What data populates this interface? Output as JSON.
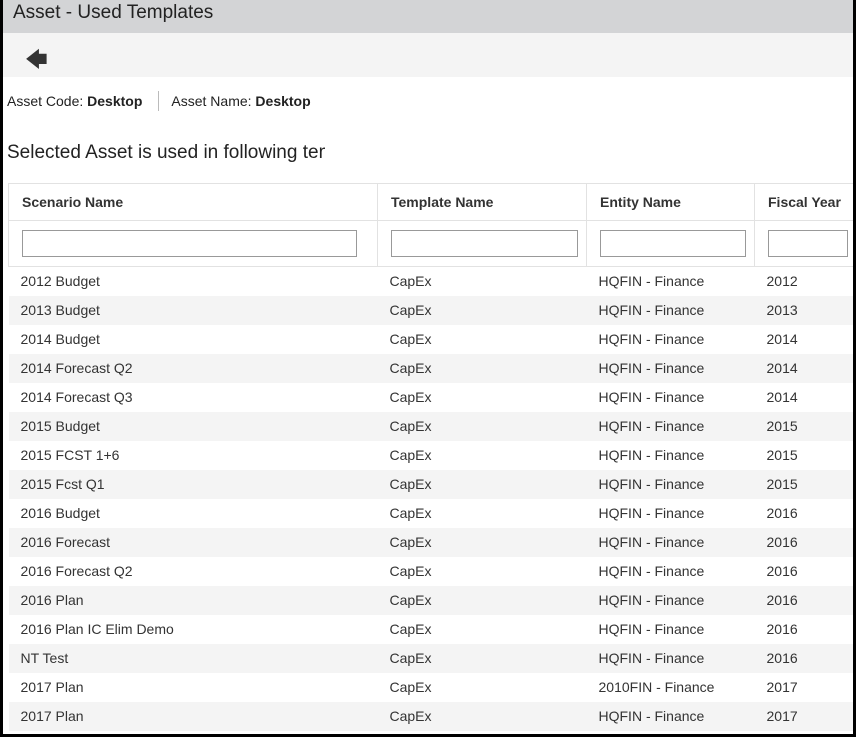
{
  "title": "Asset - Used Templates",
  "toolbar": {
    "back_icon": "arrow-left-icon"
  },
  "info": {
    "code_label": "Asset Code:",
    "code_value": "Desktop",
    "name_label": "Asset Name:",
    "name_value": "Desktop"
  },
  "heading": "Selected Asset is used in following templates",
  "columns": [
    "Scenario Name",
    "Template Name",
    "Entity Name",
    "Fiscal Year"
  ],
  "rows": [
    [
      "2012 Budget",
      "CapEx",
      "HQFIN - Finance",
      "2012"
    ],
    [
      "2013 Budget",
      "CapEx",
      "HQFIN - Finance",
      "2013"
    ],
    [
      "2014 Budget",
      "CapEx",
      "HQFIN - Finance",
      "2014"
    ],
    [
      "2014 Forecast Q2",
      "CapEx",
      "HQFIN - Finance",
      "2014"
    ],
    [
      "2014 Forecast Q3",
      "CapEx",
      "HQFIN - Finance",
      "2014"
    ],
    [
      "2015 Budget",
      "CapEx",
      "HQFIN - Finance",
      "2015"
    ],
    [
      "2015 FCST 1+6",
      "CapEx",
      "HQFIN - Finance",
      "2015"
    ],
    [
      "2015 Fcst Q1",
      "CapEx",
      "HQFIN - Finance",
      "2015"
    ],
    [
      "2016 Budget",
      "CapEx",
      "HQFIN - Finance",
      "2016"
    ],
    [
      "2016 Forecast",
      "CapEx",
      "HQFIN - Finance",
      "2016"
    ],
    [
      "2016 Forecast Q2",
      "CapEx",
      "HQFIN - Finance",
      "2016"
    ],
    [
      "2016 Plan",
      "CapEx",
      "HQFIN - Finance",
      "2016"
    ],
    [
      "2016 Plan IC Elim Demo",
      "CapEx",
      "HQFIN - Finance",
      "2016"
    ],
    [
      "NT Test",
      "CapEx",
      "HQFIN - Finance",
      "2016"
    ],
    [
      "2017 Plan",
      "CapEx",
      "2010FIN - Finance",
      "2017"
    ],
    [
      "2017 Plan",
      "CapEx",
      "HQFIN - Finance",
      "2017"
    ]
  ]
}
